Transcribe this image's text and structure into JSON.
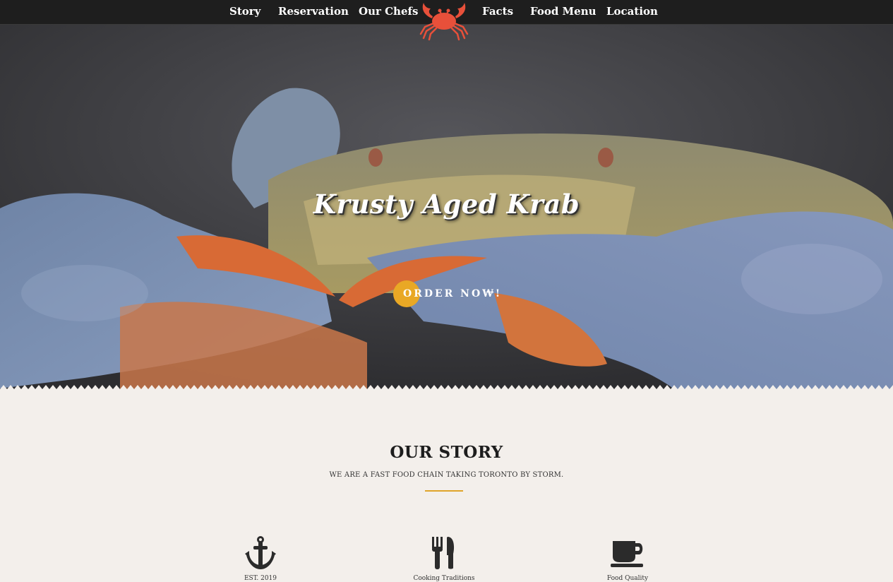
{
  "nav": {
    "items": [
      "Story",
      "Reservation",
      "Our Chefs",
      "Facts",
      "Food Menu",
      "Location"
    ]
  },
  "hero": {
    "title": "Krusty Aged Krab",
    "cta_label": "ORDER NOW!",
    "cta_arrow": "→"
  },
  "story": {
    "title": "OUR STORY",
    "subtitle": "WE ARE A FAST FOOD CHAIN TAKING TORONTO BY STORM.",
    "features": [
      {
        "icon": "anchor-icon",
        "label": "EST. 2019"
      },
      {
        "icon": "cutlery-icon",
        "label": "Cooking Traditions"
      },
      {
        "icon": "coffee-cup-icon",
        "label": "Food Quality"
      }
    ]
  },
  "colors": {
    "nav_bg": "#1e1e1e",
    "accent": "#e9a825",
    "logo": "#e8503a",
    "page_bg": "#f3efeb"
  }
}
